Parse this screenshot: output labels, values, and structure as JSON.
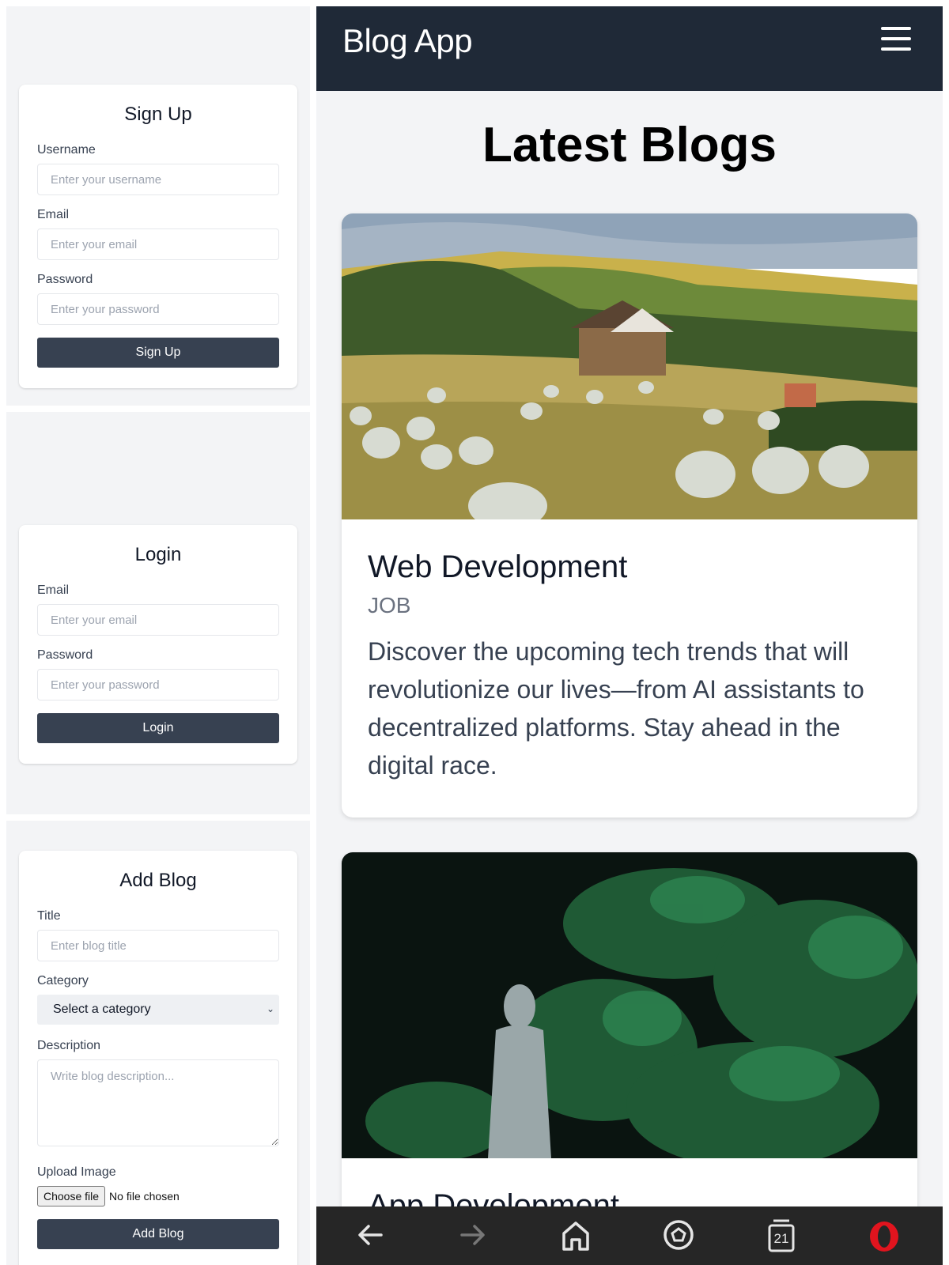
{
  "signup": {
    "title": "Sign Up",
    "username_label": "Username",
    "username_placeholder": "Enter your username",
    "email_label": "Email",
    "email_placeholder": "Enter your email",
    "password_label": "Password",
    "password_placeholder": "Enter your password",
    "submit_label": "Sign Up"
  },
  "login": {
    "title": "Login",
    "email_label": "Email",
    "email_placeholder": "Enter your email",
    "password_label": "Password",
    "password_placeholder": "Enter your password",
    "submit_label": "Login"
  },
  "add_blog": {
    "title": "Add Blog",
    "title_label": "Title",
    "title_placeholder": "Enter blog title",
    "category_label": "Category",
    "category_selected": "Select a category",
    "description_label": "Description",
    "description_placeholder": "Write blog description...",
    "image_label": "Upload Image",
    "file_button": "Choose file",
    "file_status": "No file chosen",
    "submit_label": "Add Blog"
  },
  "blog_app": {
    "app_title": "Blog App",
    "menu_icon": "hamburger-menu-icon",
    "heading": "Latest Blogs",
    "posts": [
      {
        "title": "Web Development",
        "category": "JOB",
        "description": "Discover the upcoming tech trends that will revolutionize our lives—from AI assistants to decentralized platforms. Stay ahead in the digital race.",
        "image": "farm-landscape-hay-bales"
      },
      {
        "title": "App Development",
        "image": "stone-buddha-statue-in-foliage"
      }
    ]
  },
  "browser_nav": {
    "icons": [
      "back-arrow-icon",
      "forward-arrow-icon",
      "home-icon",
      "speed-dial-icon",
      "tabs-icon",
      "opera-icon"
    ],
    "tab_count": "21"
  },
  "colors": {
    "app_bar": "#1f2937",
    "button": "#374151",
    "panel_bg": "#f3f4f6",
    "opera_red": "#e1141e"
  }
}
